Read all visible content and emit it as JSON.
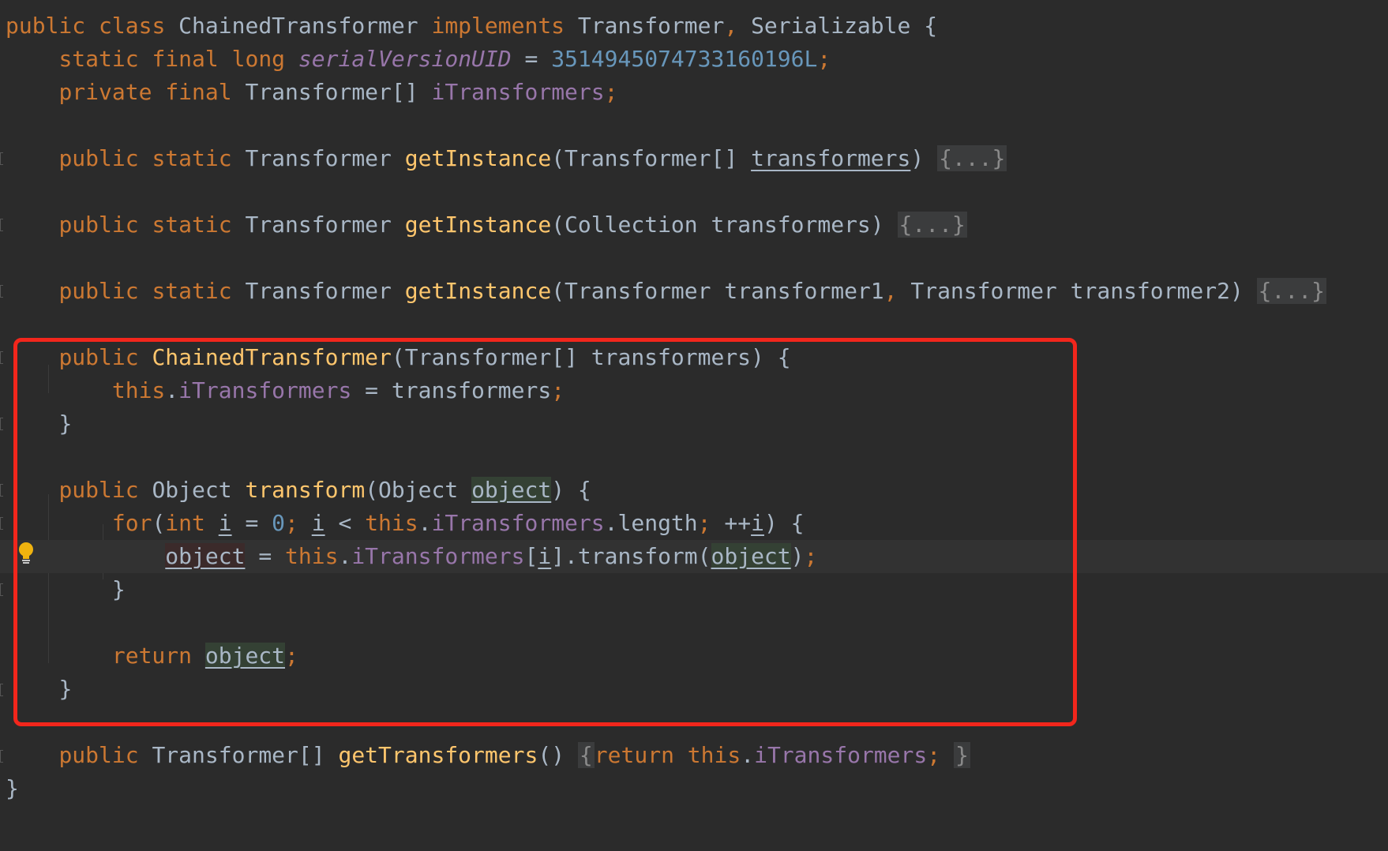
{
  "code": {
    "l1": {
      "a": "public",
      "b": "class",
      "c": "ChainedTransformer",
      "d": "implements",
      "e": "Transformer",
      "f": ",",
      "g": "Serializable",
      "h": "{"
    },
    "l2": {
      "a": "static",
      "b": "final",
      "c": "long",
      "d": "serialVersionUID",
      "e": "=",
      "f": "3514945074733160196L",
      "g": ";"
    },
    "l3": {
      "a": "private",
      "b": "final",
      "c": "Transformer[]",
      "d": "iTransformers",
      "e": ";"
    },
    "l4": {
      "a": "public",
      "b": "static",
      "c": "Transformer",
      "d": "getInstance",
      "e": "(Transformer[]",
      "f": "transformers",
      "g": ")",
      "fold": "{...}"
    },
    "l5": {
      "a": "public",
      "b": "static",
      "c": "Transformer",
      "d": "getInstance",
      "e": "(Collection transformers)",
      "fold": "{...}"
    },
    "l6": {
      "a": "public",
      "b": "static",
      "c": "Transformer",
      "d": "getInstance",
      "e": "(Transformer transformer1",
      "f": ",",
      "g": "Transformer transformer2)",
      "fold": "{...}"
    },
    "l7": {
      "a": "public",
      "b": "ChainedTransformer",
      "c": "(Transformer[] transformers) {"
    },
    "l8": {
      "a": "this",
      "b": ".",
      "c": "iTransformers",
      "d": "= transformers",
      "e": ";"
    },
    "l9": {
      "a": "}"
    },
    "l10": {
      "a": "public",
      "b": "Object",
      "c": "transform",
      "d": "(Object",
      "e": "object",
      "f": ") {"
    },
    "l11": {
      "a": "for",
      "b": "(",
      "c": "int",
      "d": "i",
      "e": "=",
      "f": "0",
      "g": ";",
      "h": "i",
      "i": "<",
      "j": "this",
      "k": ".",
      "l": "iTransformers",
      "m": ".length",
      "n": ";",
      "o": "++",
      "p": "i",
      "q": ") {"
    },
    "l12": {
      "a": "object",
      "b": "=",
      "c": "this",
      "d": ".",
      "e": "iTransformers",
      "f": "[",
      "g": "i",
      "h": "].transform(",
      "i": "object",
      "j": ")",
      "k": ";"
    },
    "l13": {
      "a": "}"
    },
    "l14": {
      "a": "return",
      "b": "object",
      "c": ";"
    },
    "l15": {
      "a": "}"
    },
    "l16": {
      "a": "public",
      "b": "Transformer[]",
      "c": "getTransformers",
      "d": "()",
      "e": "{",
      "f": "return",
      "g": "this",
      "h": ".",
      "i": "iTransformers",
      "j": ";",
      "k": "}"
    },
    "l17": {
      "a": "}"
    }
  },
  "colors": {
    "background": "#2b2b2b",
    "keyword": "#cc7832",
    "method": "#ffc66d",
    "field": "#9876aa",
    "number": "#6897bb",
    "text": "#a9b7c6",
    "highlight_box": "#f2261c"
  },
  "icons": {
    "gutter_hint": "lightbulb-icon"
  }
}
